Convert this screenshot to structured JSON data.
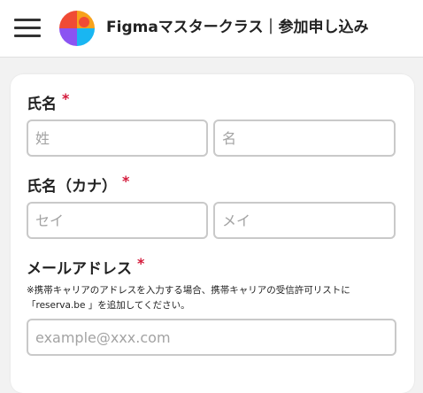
{
  "header": {
    "title": "Figmaマスタークラス｜参加申し込み"
  },
  "form": {
    "name": {
      "label": "氏名",
      "required_mark": "*",
      "last_placeholder": "姓",
      "first_placeholder": "名"
    },
    "kana": {
      "label": "氏名（カナ）",
      "required_mark": "*",
      "last_placeholder": "セイ",
      "first_placeholder": "メイ"
    },
    "email": {
      "label": "メールアドレス",
      "required_mark": "*",
      "note_line1": "※携帯キャリアのアドレスを入力する場合、携帯キャリアの受信許可リストに",
      "note_line2": "「reserva.be 」を追加してください。",
      "placeholder": "example@xxx.com"
    }
  },
  "colors": {
    "required": "#d4193a",
    "input_border": "#c9c9c9",
    "logo_red": "#f04b35",
    "logo_orange": "#f7a21b",
    "logo_purple": "#8b54f2",
    "logo_blue": "#19b6f2"
  }
}
